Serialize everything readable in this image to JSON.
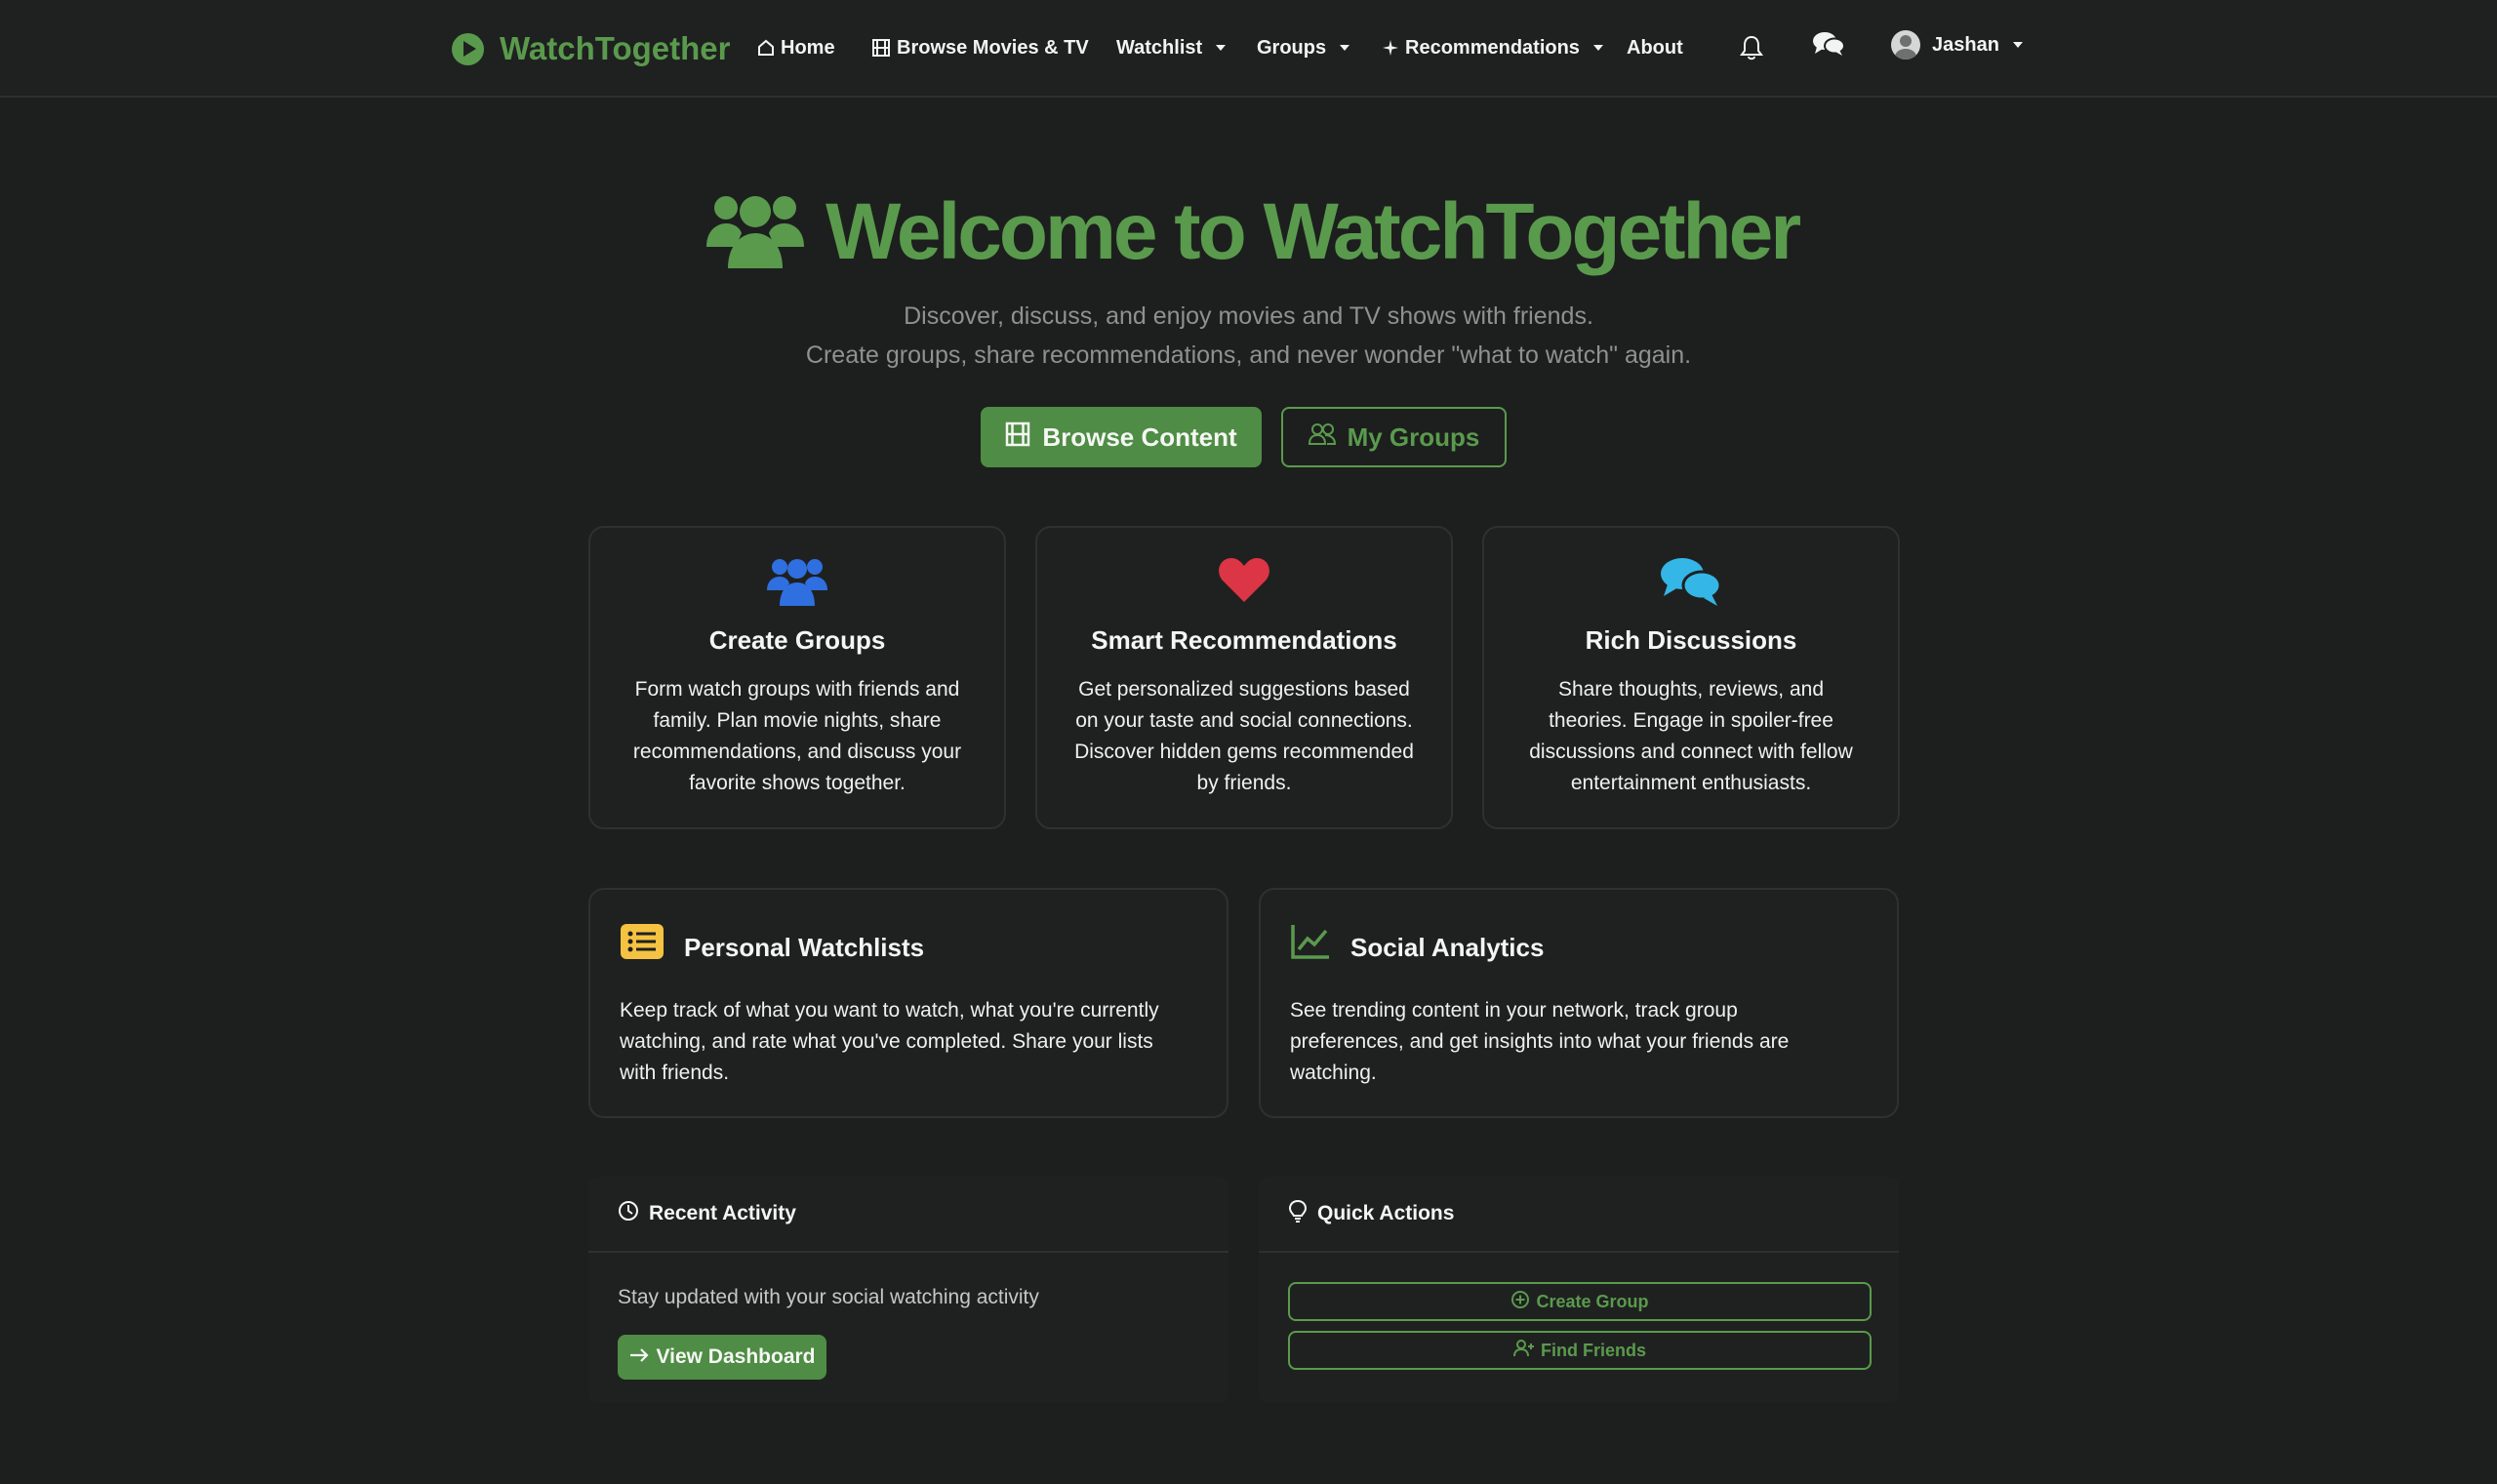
{
  "navbar": {
    "brand": "WatchTogether",
    "items": [
      {
        "label": "Home",
        "icon": "home-icon"
      },
      {
        "label": "Browse Movies & TV",
        "icon": "film-icon"
      },
      {
        "label": "Watchlist",
        "dropdown": true
      },
      {
        "label": "Groups",
        "dropdown": true
      },
      {
        "label": "Recommendations",
        "icon": "sparkle-icon",
        "dropdown": true
      },
      {
        "label": "About"
      }
    ],
    "notifications_icon": "bell-icon",
    "messages_icon": "chat-icon",
    "user": {
      "name": "Jashan",
      "icon": "user-avatar-icon"
    }
  },
  "hero": {
    "title": "Welcome to WatchTogether",
    "subtitle_line1": "Discover, discuss, and enjoy movies and TV shows with friends.",
    "subtitle_line2": "Create groups, share recommendations, and never wonder \"what to watch\" again.",
    "browse_button": "Browse Content",
    "groups_button": "My Groups"
  },
  "features": [
    {
      "title": "Create Groups",
      "icon": "people-icon",
      "text": "Form watch groups with friends and family. Plan movie nights, share recommendations, and discuss your favorite shows together."
    },
    {
      "title": "Smart Recommendations",
      "icon": "heart-icon",
      "text": "Get personalized suggestions based on your taste and social connections. Discover hidden gems recommended by friends."
    },
    {
      "title": "Rich Discussions",
      "icon": "chat-bubbles-icon",
      "text": "Share thoughts, reviews, and theories. Engage in spoiler-free discussions and connect with fellow entertainment enthusiasts."
    }
  ],
  "wide_features": [
    {
      "title": "Personal Watchlists",
      "icon": "list-icon",
      "text": "Keep track of what you want to watch, what you're currently watching, and rate what you've completed. Share your lists with friends."
    },
    {
      "title": "Social Analytics",
      "icon": "chart-line-icon",
      "text": "See trending content in your network, track group preferences, and get insights into what your friends are watching."
    }
  ],
  "recent_activity": {
    "title": "Recent Activity",
    "text": "Stay updated with your social watching activity",
    "button": "View Dashboard"
  },
  "quick_actions": {
    "title": "Quick Actions",
    "create_group": "Create Group",
    "find_friends": "Find Friends"
  },
  "colors": {
    "accent": "#5a9a4d",
    "background": "#1d1f1e",
    "card": "#1f2120",
    "groups_icon": "#2f6fe0",
    "heart_icon": "#dc3545",
    "chat_icon": "#34b7e6",
    "list_icon": "#f5c242"
  }
}
